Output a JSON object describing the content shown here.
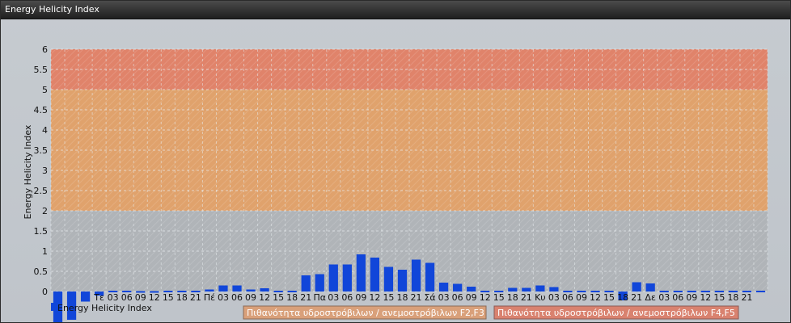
{
  "window": {
    "title": "Energy Helicity Index"
  },
  "colors": {
    "bar": "#1146d9",
    "band_low": "#b0b4b8",
    "band_mid": "#e0a26c",
    "band_high": "#e0836a",
    "grid": "#e8ecef"
  },
  "legend": {
    "series_label": "Energy Helicity Index",
    "bands": [
      {
        "label": "Πιθανότητα υδροστρόβιλων / ανεμοστρόβιλων F2,F3",
        "color": "#d9a07a"
      },
      {
        "label": "Πιθανότητα υδροστρόβιλων / ανεμοστρόβιλων F4,F5",
        "color": "#d9826f"
      }
    ]
  },
  "chart_data": {
    "type": "bar",
    "title": "Energy Helicity Index",
    "ylabel": "Energy Helicity Index",
    "ylim": [
      0,
      6
    ],
    "yticks": [
      "0",
      "0.5",
      "1",
      "1.5",
      "2",
      "2.5",
      "3",
      "3.5",
      "4",
      "4.5",
      "5",
      "5.5",
      "6"
    ],
    "bands": [
      {
        "from": 0,
        "to": 2,
        "color": "#b0b4b8"
      },
      {
        "from": 2,
        "to": 5,
        "color": "#e0a26c"
      },
      {
        "from": 5,
        "to": 6,
        "color": "#e0836a"
      }
    ],
    "grid": true,
    "legend_position": "bottom",
    "categories": [
      "",
      "",
      "",
      "Τε",
      "03",
      "06",
      "09",
      "12",
      "15",
      "18",
      "21",
      "Πέ",
      "03",
      "06",
      "09",
      "12",
      "15",
      "18",
      "21",
      "Πα",
      "03",
      "06",
      "09",
      "12",
      "15",
      "18",
      "21",
      "Σά",
      "03",
      "06",
      "09",
      "12",
      "15",
      "18",
      "21",
      "Κυ",
      "03",
      "06",
      "09",
      "12",
      "15",
      "18",
      "21",
      "Δε",
      "03",
      "06",
      "09",
      "12",
      "15",
      "18",
      "21",
      ""
    ],
    "values": [
      -0.8,
      -0.7,
      -0.25,
      -0.1,
      0.02,
      0.02,
      0.01,
      0.01,
      0.02,
      0.02,
      0.02,
      0.05,
      0.15,
      0.15,
      0.05,
      0.08,
      0.02,
      0.02,
      0.4,
      0.43,
      0.67,
      0.67,
      0.92,
      0.84,
      0.61,
      0.54,
      0.79,
      0.71,
      0.22,
      0.19,
      0.12,
      0.02,
      0.02,
      0.09,
      0.09,
      0.15,
      0.11,
      0.02,
      0.02,
      0.02,
      0.02,
      -0.22,
      0.23,
      0.2,
      0.02,
      0.02,
      0.02,
      0.02,
      0.02,
      0.02,
      0.02,
      0.02
    ]
  }
}
